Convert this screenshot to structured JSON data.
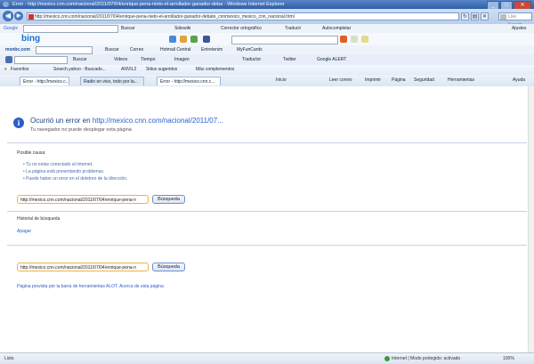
{
  "window": {
    "title": "Error - http://mexico.cnn.com/nacional/2011/07/04/enrique-pena-nieto-el-arrollador-ganador-deba - Windows Internet Explorer",
    "minimize": "_",
    "maximize": "□",
    "close": "✕"
  },
  "address_bar": {
    "url": "http://mexico.cnn.com/nacional/2011/07/04/enrique-pena-nieto-el-arrollador-ganador-debate_cnnmexico_mexico_cnn_nacional.html",
    "search_placeholder": "Live Search",
    "back": "◀",
    "forward": "▶"
  },
  "google_toolbar": {
    "label": "Google",
    "buscar": "Buscar",
    "items": [
      "Sidewiki",
      "Corrector ortográfico",
      "Traducir",
      "Autocompletar"
    ],
    "settings": "Ajustes"
  },
  "bing_toolbar": {
    "logo": "bing"
  },
  "msn_toolbar": {
    "label": "msnbc.com",
    "items": [
      "Buscar",
      "Correo",
      "Hotmail Central",
      "Entretenim",
      "MyFunCards"
    ]
  },
  "links_toolbar": {
    "items": [
      "Buscar",
      "Videos",
      "Tiempo",
      "Imagen",
      "Traductor",
      "Twitter",
      "Google ALERT"
    ]
  },
  "favorites_bar": {
    "label": "Favoritos",
    "items": [
      "Search.yahoo - Buscado...",
      "ANVIL2",
      "Sitios sugeridos",
      "Más complementos"
    ]
  },
  "tabs": {
    "items": [
      "Error - http://mexico.c...",
      "Radio en vivo, todo por la...",
      "Error - http://mexico.cnn.c..."
    ],
    "commands": [
      "Inicio",
      "Leer correo",
      "Imprimir",
      "Página",
      "Seguridad",
      "Herramientas",
      "Ayuda"
    ]
  },
  "error_page": {
    "title_prefix": "Ocurrió un error en",
    "title_link": "http://mexico.cnn.com/nacional/2011/07...",
    "subtitle": "Tu navegador no puede desplegar esta página",
    "causes_label": "Posible causa:",
    "causes": [
      "Tu no estás conectado al Internet.",
      "La página está presentando problemas.",
      "Puede haber un error en el deletreo de la dirección."
    ],
    "url_value": "http://mexico.cnn.com/nacional/2011/07/04/enrique-pena-n",
    "go_label": "Búsqueda",
    "history_label": "Historial de búsqueda",
    "clear_label": "Apagar",
    "footer": "Página provista por la barra de herramientas ALOT. Acerca de esta página"
  },
  "status_bar": {
    "left": "Listo",
    "zone": "Internet | Modo protegido: activado",
    "zoom": "100%"
  }
}
